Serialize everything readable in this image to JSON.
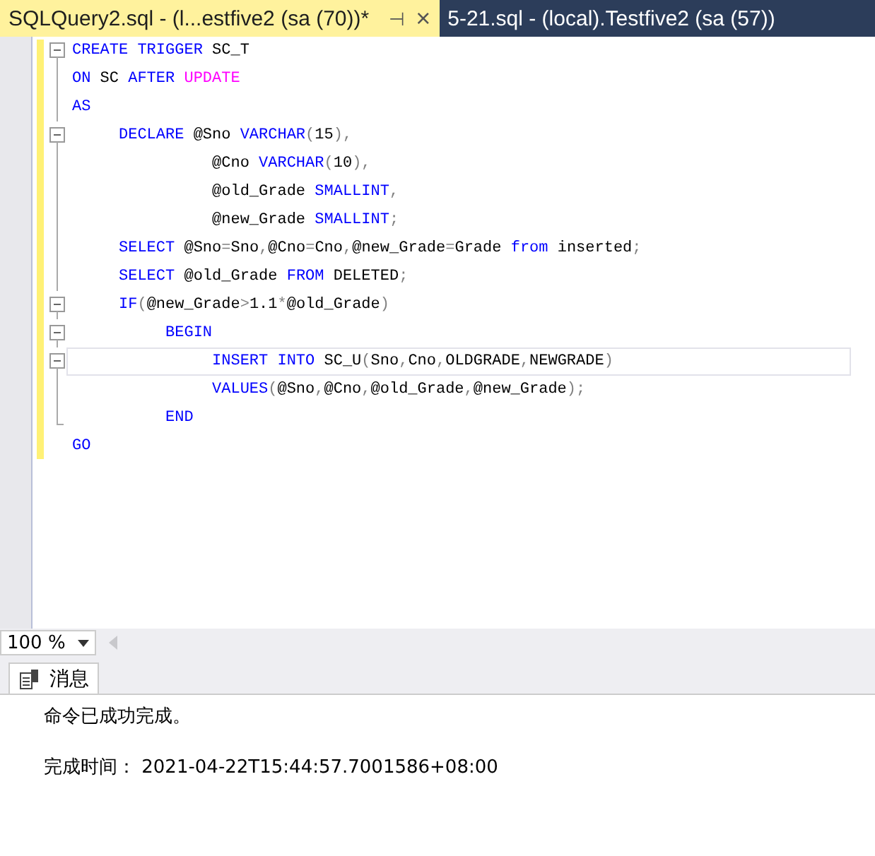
{
  "tabs": [
    {
      "label": "SQLQuery2.sql - (l...estfive2 (sa (70))*",
      "selected": true,
      "pin": "⊣",
      "close": "×"
    },
    {
      "label": "5-21.sql - (local).Testfive2 (sa (57))",
      "selected": false
    }
  ],
  "editor": {
    "lines": [
      {
        "kind": "box",
        "current": false,
        "tokens": [
          {
            "t": "CREATE TRIGGER",
            "kind": "kw"
          },
          {
            "t": " SC_T",
            "kind": "id"
          }
        ]
      },
      {
        "kind": "line",
        "current": false,
        "tokens": [
          {
            "t": "ON",
            "kind": "kw"
          },
          {
            "t": " SC ",
            "kind": "id"
          },
          {
            "t": "AFTER ",
            "kind": "kw"
          },
          {
            "t": "UPDATE",
            "kind": "fn"
          }
        ]
      },
      {
        "kind": "line",
        "current": false,
        "tokens": [
          {
            "t": "AS",
            "kind": "kw"
          }
        ]
      },
      {
        "kind": "box",
        "current": false,
        "tokens": [
          {
            "t": "     DECLARE",
            "kind": "kw"
          },
          {
            "t": " @Sno ",
            "kind": "id"
          },
          {
            "t": "VARCHAR",
            "kind": "kw"
          },
          {
            "t": "(",
            "kind": "op"
          },
          {
            "t": "15",
            "kind": "id"
          },
          {
            "t": "),",
            "kind": "op"
          }
        ]
      },
      {
        "kind": "line",
        "current": false,
        "tokens": [
          {
            "t": "               @Cno ",
            "kind": "id"
          },
          {
            "t": "VARCHAR",
            "kind": "kw"
          },
          {
            "t": "(",
            "kind": "op"
          },
          {
            "t": "10",
            "kind": "id"
          },
          {
            "t": "),",
            "kind": "op"
          }
        ]
      },
      {
        "kind": "line",
        "current": false,
        "tokens": [
          {
            "t": "               @old_Grade ",
            "kind": "id"
          },
          {
            "t": "SMALLINT",
            "kind": "kw"
          },
          {
            "t": ",",
            "kind": "op"
          }
        ]
      },
      {
        "kind": "line",
        "current": false,
        "tokens": [
          {
            "t": "               @new_Grade ",
            "kind": "id"
          },
          {
            "t": "SMALLINT",
            "kind": "kw"
          },
          {
            "t": ";",
            "kind": "op"
          }
        ]
      },
      {
        "kind": "line",
        "current": false,
        "tokens": [
          {
            "t": "     SELECT",
            "kind": "kw"
          },
          {
            "t": " @Sno",
            "kind": "id"
          },
          {
            "t": "=",
            "kind": "op"
          },
          {
            "t": "Sno",
            "kind": "id"
          },
          {
            "t": ",",
            "kind": "op"
          },
          {
            "t": "@Cno",
            "kind": "id"
          },
          {
            "t": "=",
            "kind": "op"
          },
          {
            "t": "Cno",
            "kind": "id"
          },
          {
            "t": ",",
            "kind": "op"
          },
          {
            "t": "@new_Grade",
            "kind": "id"
          },
          {
            "t": "=",
            "kind": "op"
          },
          {
            "t": "Grade ",
            "kind": "id"
          },
          {
            "t": "from",
            "kind": "kw"
          },
          {
            "t": " inserted",
            "kind": "id"
          },
          {
            "t": ";",
            "kind": "op"
          }
        ]
      },
      {
        "kind": "line",
        "current": false,
        "tokens": [
          {
            "t": "     SELECT",
            "kind": "kw"
          },
          {
            "t": " @old_Grade ",
            "kind": "id"
          },
          {
            "t": "FROM",
            "kind": "kw"
          },
          {
            "t": " DELETED",
            "kind": "id"
          },
          {
            "t": ";",
            "kind": "op"
          }
        ]
      },
      {
        "kind": "box",
        "current": false,
        "tokens": [
          {
            "t": "     IF",
            "kind": "kw"
          },
          {
            "t": "(",
            "kind": "op"
          },
          {
            "t": "@new_Grade",
            "kind": "id"
          },
          {
            "t": ">",
            "kind": "op"
          },
          {
            "t": "1.1",
            "kind": "id"
          },
          {
            "t": "*",
            "kind": "op"
          },
          {
            "t": "@old_Grade",
            "kind": "id"
          },
          {
            "t": ")",
            "kind": "op"
          }
        ]
      },
      {
        "kind": "box",
        "current": false,
        "tokens": [
          {
            "t": "          BEGIN",
            "kind": "kw"
          }
        ]
      },
      {
        "kind": "box",
        "current": true,
        "tokens": [
          {
            "t": "               INSERT INTO",
            "kind": "kw"
          },
          {
            "t": " SC_U",
            "kind": "id"
          },
          {
            "t": "(",
            "kind": "op"
          },
          {
            "t": "Sno",
            "kind": "id"
          },
          {
            "t": ",",
            "kind": "op"
          },
          {
            "t": "Cno",
            "kind": "id"
          },
          {
            "t": ",",
            "kind": "op"
          },
          {
            "t": "OLDGRADE",
            "kind": "id"
          },
          {
            "t": ",",
            "kind": "op"
          },
          {
            "t": "NEWGRADE",
            "kind": "id"
          },
          {
            "t": ")",
            "kind": "op"
          }
        ]
      },
      {
        "kind": "line",
        "current": false,
        "tokens": [
          {
            "t": "               VALUES",
            "kind": "kw"
          },
          {
            "t": "(",
            "kind": "op"
          },
          {
            "t": "@Sno",
            "kind": "id"
          },
          {
            "t": ",",
            "kind": "op"
          },
          {
            "t": "@Cno",
            "kind": "id"
          },
          {
            "t": ",",
            "kind": "op"
          },
          {
            "t": "@old_Grade",
            "kind": "id"
          },
          {
            "t": ",",
            "kind": "op"
          },
          {
            "t": "@new_Grade",
            "kind": "id"
          },
          {
            "t": ");",
            "kind": "op"
          }
        ]
      },
      {
        "kind": "end",
        "current": false,
        "tokens": [
          {
            "t": "          END",
            "kind": "kw"
          }
        ]
      },
      {
        "kind": "none",
        "current": false,
        "tokens": [
          {
            "t": "GO",
            "kind": "kw"
          }
        ]
      }
    ]
  },
  "zoom": {
    "value": "100 %"
  },
  "results": {
    "tab": "消息",
    "messages": [
      "命令已成功完成。",
      "完成时间： 2021-04-22T15:44:57.7001586+08:00"
    ]
  }
}
